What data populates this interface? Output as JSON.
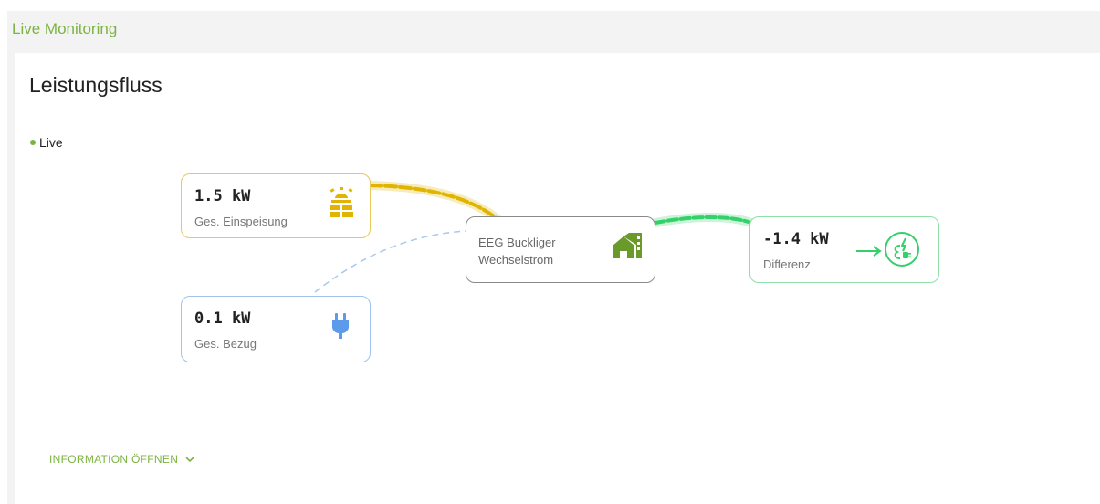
{
  "header": {
    "title": "Live Monitoring"
  },
  "card": {
    "title": "Leistungsfluss",
    "live_label": "Live"
  },
  "nodes": {
    "solar": {
      "value": "1.5 kW",
      "label": "Ges. Einspeisung",
      "icon": "solar-panel-icon"
    },
    "grid": {
      "value": "0.1 kW",
      "label": "Ges. Bezug",
      "icon": "plug-icon"
    },
    "hub": {
      "line1": "EEG Buckliger",
      "line2": "Wechselstrom",
      "icon": "house-icon"
    },
    "difference": {
      "value": "-1.4 kW",
      "label": "Differenz",
      "icon": "grid-power-icon"
    }
  },
  "footer": {
    "info_button_label": "INFORMATION ÖFFNEN"
  },
  "colors": {
    "accent": "#7cb342",
    "solar": "#e0b400",
    "grid": "#5b9bea",
    "export": "#34d06a",
    "hub_icon": "#6a9a2a"
  }
}
